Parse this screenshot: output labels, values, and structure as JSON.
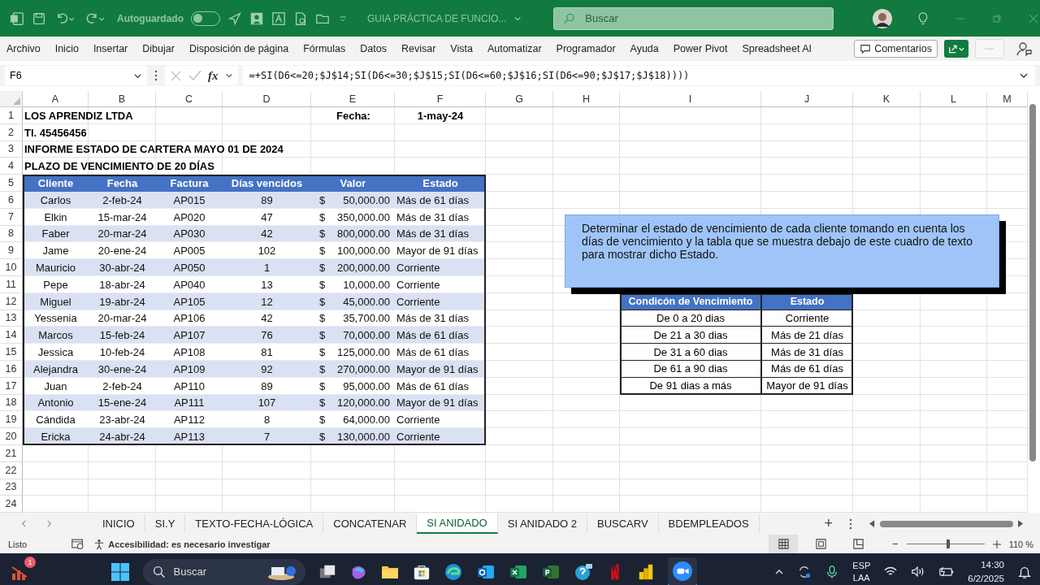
{
  "title_bar": {
    "autosave_label": "Autoguardado",
    "autosave": {
      "on": false
    },
    "document_title": "GUIA PRÁCTICA DE FUNCIO...",
    "search": {
      "placeholder": "Buscar"
    }
  },
  "ribbon_tabs": [
    "Archivo",
    "Inicio",
    "Insertar",
    "Dibujar",
    "Disposición de página",
    "Fórmulas",
    "Datos",
    "Revisar",
    "Vista",
    "Automatizar",
    "Programador",
    "Ayuda",
    "Power Pivot",
    "Spreadsheet AI"
  ],
  "comments_button": "Comentarios",
  "formula_bar": {
    "name_box": "F6",
    "fx": "fx",
    "formula": "=+SI(D6<=20;$J$14;SI(D6<=30;$J$15;SI(D6<=60;$J$16;SI(D6<=90;$J$17;$J$18))))"
  },
  "sheet": {
    "columns": [
      "A",
      "B",
      "C",
      "D",
      "E",
      "F",
      "G",
      "H",
      "I",
      "J",
      "K",
      "L",
      "M"
    ],
    "row_numbers": [
      "1",
      "2",
      "3",
      "4",
      "5",
      "6",
      "7",
      "8",
      "9",
      "10",
      "11",
      "12",
      "13",
      "14",
      "15",
      "16",
      "17",
      "18",
      "19",
      "20",
      "21",
      "22",
      "23",
      "24"
    ],
    "header_lines": [
      "LOS APRENDIZ LTDA",
      "Tl. 45456456",
      "INFORME ESTADO DE CARTERA MAYO 01 DE 2024",
      "PLAZO DE VENCIMIENTO DE 20 DÍAS"
    ],
    "date_label": "Fecha:",
    "date_value": "1-may-24",
    "table": {
      "columns": [
        "Cliente",
        "Fecha",
        "Factura",
        "Días vencidos",
        "Valor",
        "Estado"
      ],
      "rows": [
        {
          "cliente": "Carlos",
          "fecha": "2-feb-24",
          "factura": "AP015",
          "dias": "89",
          "moneda": "$",
          "valor": "50,000.00",
          "estado": "Más de 61 días"
        },
        {
          "cliente": "Elkin",
          "fecha": "15-mar-24",
          "factura": "AP020",
          "dias": "47",
          "moneda": "$",
          "valor": "350,000.00",
          "estado": "Más de 31 días"
        },
        {
          "cliente": "Faber",
          "fecha": "20-mar-24",
          "factura": "AP030",
          "dias": "42",
          "moneda": "$",
          "valor": "800,000.00",
          "estado": "Más de 31 días"
        },
        {
          "cliente": "Jame",
          "fecha": "20-ene-24",
          "factura": "AP005",
          "dias": "102",
          "moneda": "$",
          "valor": "100,000.00",
          "estado": "Mayor de 91 días"
        },
        {
          "cliente": "Mauricio",
          "fecha": "30-abr-24",
          "factura": "AP050",
          "dias": "1",
          "moneda": "$",
          "valor": "200,000.00",
          "estado": "Corriente"
        },
        {
          "cliente": "Pepe",
          "fecha": "18-abr-24",
          "factura": "AP040",
          "dias": "13",
          "moneda": "$",
          "valor": "10,000.00",
          "estado": "Corriente"
        },
        {
          "cliente": "Miguel",
          "fecha": "19-abr-24",
          "factura": "AP105",
          "dias": "12",
          "moneda": "$",
          "valor": "45,000.00",
          "estado": "Corriente"
        },
        {
          "cliente": "Yessenia",
          "fecha": "20-mar-24",
          "factura": "AP106",
          "dias": "42",
          "moneda": "$",
          "valor": "35,700.00",
          "estado": "Más de 31 días"
        },
        {
          "cliente": "Marcos",
          "fecha": "15-feb-24",
          "factura": "AP107",
          "dias": "76",
          "moneda": "$",
          "valor": "70,000.00",
          "estado": "Más de 61 días"
        },
        {
          "cliente": "Jessica",
          "fecha": "10-feb-24",
          "factura": "AP108",
          "dias": "81",
          "moneda": "$",
          "valor": "125,000.00",
          "estado": "Más de 61 días"
        },
        {
          "cliente": "Alejandra",
          "fecha": "30-ene-24",
          "factura": "AP109",
          "dias": "92",
          "moneda": "$",
          "valor": "270,000.00",
          "estado": "Mayor de 91 días"
        },
        {
          "cliente": "Juan",
          "fecha": "2-feb-24",
          "factura": "AP110",
          "dias": "89",
          "moneda": "$",
          "valor": "95,000.00",
          "estado": "Más de 61 días"
        },
        {
          "cliente": "Antonio",
          "fecha": "15-ene-24",
          "factura": "AP111",
          "dias": "107",
          "moneda": "$",
          "valor": "120,000.00",
          "estado": "Mayor de 91 días"
        },
        {
          "cliente": "Cándida",
          "fecha": "23-abr-24",
          "factura": "AP112",
          "dias": "8",
          "moneda": "$",
          "valor": "64,000.00",
          "estado": "Corriente"
        },
        {
          "cliente": "Ericka",
          "fecha": "24-abr-24",
          "factura": "AP113",
          "dias": "7",
          "moneda": "$",
          "valor": "130,000.00",
          "estado": "Corriente"
        }
      ]
    },
    "text_box": "Determinar el estado de vencimiento de cada cliente tomando en cuenta los días de vencimiento y la tabla que se muestra debajo de este cuadro de texto para mostrar dicho Estado.",
    "legend": {
      "columns": [
        "Condicón de Vencimiento",
        "Estado"
      ],
      "rows": [
        {
          "condicion": "De 0 a 20 dias",
          "estado": "Corriente"
        },
        {
          "condicion": "De 21 a 30 dias",
          "estado": "Más de 21 días"
        },
        {
          "condicion": "De 31 a 60 dias",
          "estado": "Más de 31 días"
        },
        {
          "condicion": "De 61 a 90 dias",
          "estado": "Más de 61 días"
        },
        {
          "condicion": "De 91 dias a más",
          "estado": "Mayor de 91 días"
        }
      ]
    }
  },
  "sheet_tabs": [
    {
      "label": "INICIO",
      "selected": false
    },
    {
      "label": "SI.Y",
      "selected": false
    },
    {
      "label": "TEXTO-FECHA-LÓGICA",
      "selected": false
    },
    {
      "label": "CONCATENAR",
      "selected": false
    },
    {
      "label": "SI ANIDADO",
      "selected": true
    },
    {
      "label": "SI ANIDADO 2",
      "selected": false
    },
    {
      "label": "BUSCARV",
      "selected": false
    },
    {
      "label": "BDEMPLEADOS",
      "selected": false
    }
  ],
  "add_sheet": "+",
  "status_bar": {
    "state": "Listo",
    "accessibility": "Accesibilidad: es necesario investigar",
    "zoom": {
      "level": 0.53
    },
    "zoom_out": "−",
    "zoom_text": "110 %"
  },
  "taskbar": {
    "widget_badge": "1",
    "search_placeholder": "Buscar",
    "language": [
      "ESP",
      "LAA"
    ],
    "time": "14:30",
    "date": "6/2/2025"
  }
}
